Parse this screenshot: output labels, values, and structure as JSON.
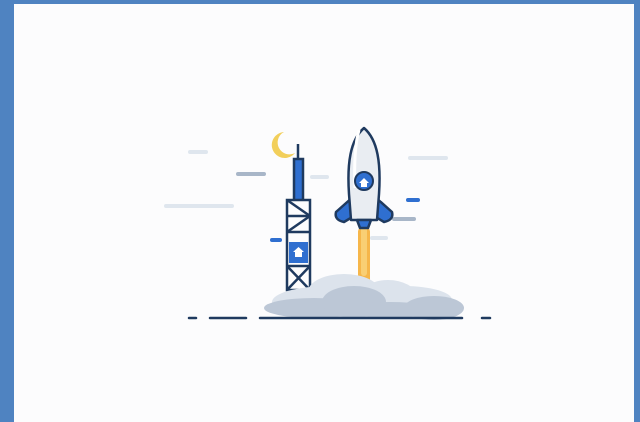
{
  "window": {
    "frame_color": "#4f83c1",
    "background_color": "#fcfcfd"
  },
  "illustration": {
    "subject": "rocket-launch",
    "icons": [
      "moon-icon",
      "launch-tower-icon",
      "rocket-icon",
      "cloud-icon",
      "smoke-icon",
      "flame-icon"
    ],
    "colors": {
      "outline": "#1f3a5f",
      "primary_blue": "#2f6fd0",
      "moon_yellow": "#f2cf5b",
      "flame_orange": "#f6b64a",
      "smoke_gray": "#bcc7d6",
      "smoke_light": "#dce3ec",
      "accent_line": "#dfe6ee"
    }
  }
}
